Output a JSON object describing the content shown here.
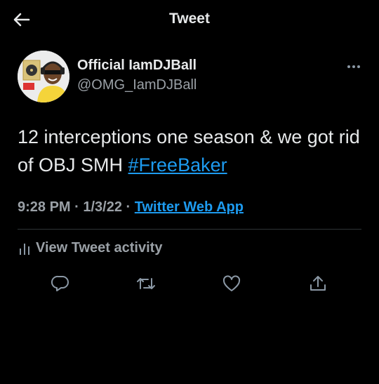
{
  "header": {
    "title": "Tweet",
    "back_icon": "arrow-left-icon"
  },
  "author": {
    "display_name": "Official IamDJBall",
    "handle": "@OMG_IamDJBall",
    "avatar_icon": "avatar"
  },
  "tweet": {
    "text": "12 interceptions one season & we got rid of OBJ SMH ",
    "hashtag": "#FreeBaker",
    "time": "9:28 PM",
    "separator": " · ",
    "date": "1/3/22",
    "source": "Twitter Web App"
  },
  "activity": {
    "label": "View Tweet activity",
    "icon": "bar-chart-icon"
  },
  "actions": [
    {
      "name": "reply-icon"
    },
    {
      "name": "retweet-icon"
    },
    {
      "name": "like-icon"
    },
    {
      "name": "share-icon"
    }
  ],
  "colors": {
    "background": "#000000",
    "text": "#e7e9ea",
    "secondary": "#9aa0a6",
    "link": "#1d9bf0",
    "divider": "#2f3336"
  }
}
